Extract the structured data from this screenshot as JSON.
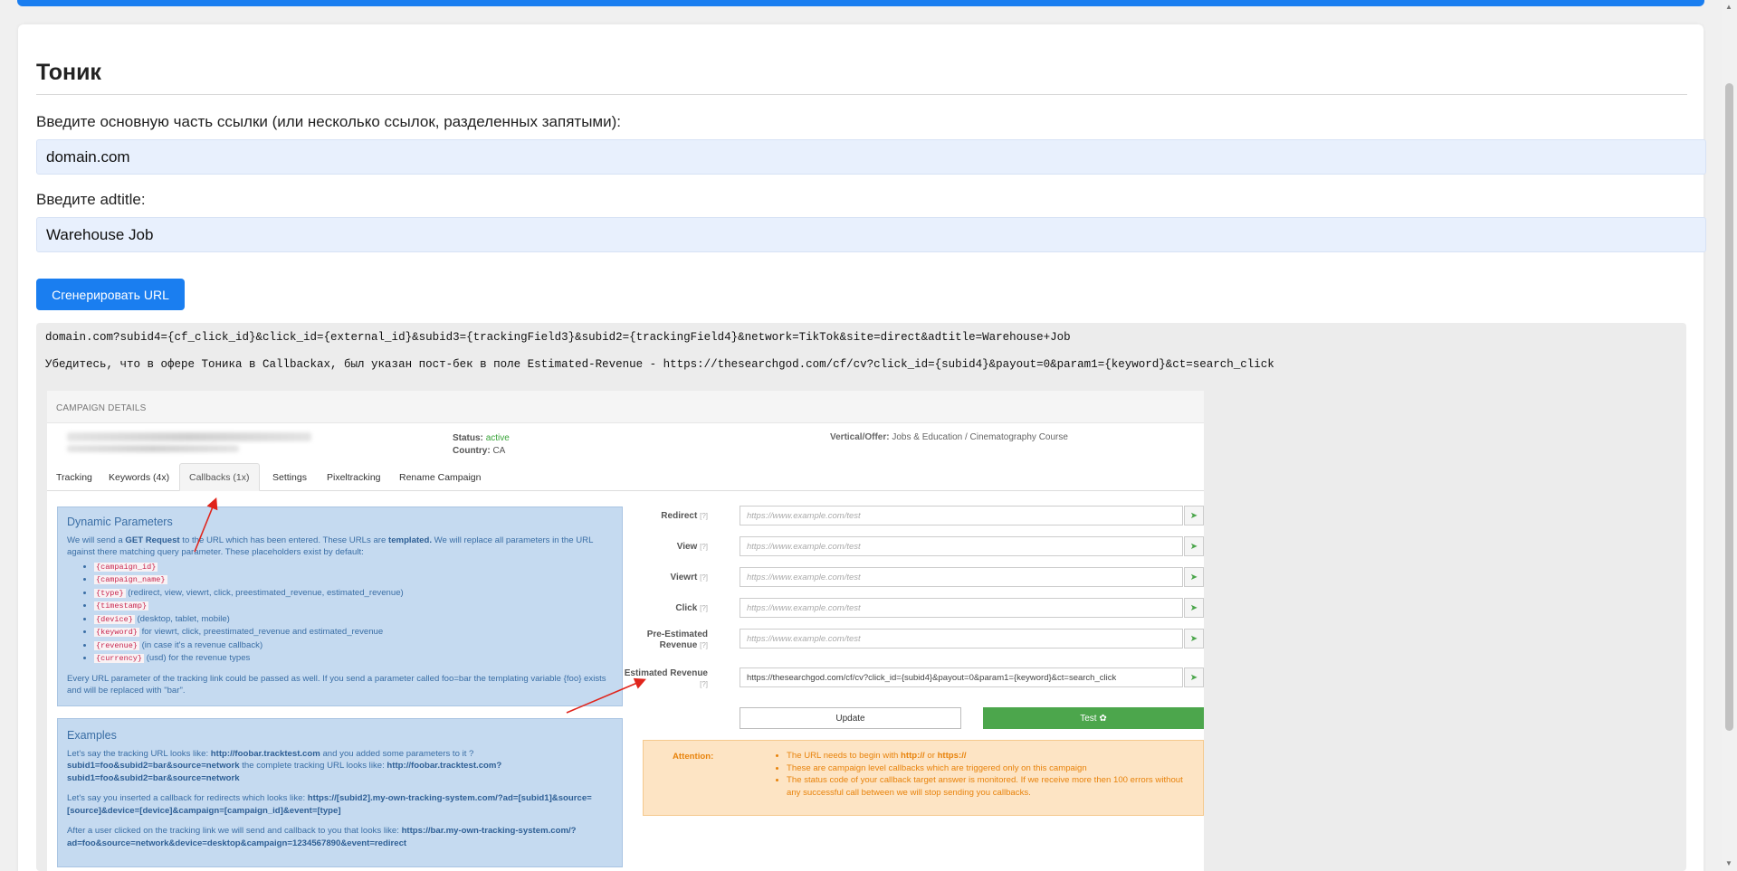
{
  "page": {
    "title": "Тоник",
    "link_label": "Введите основную часть ссылки (или несколько ссылок, разделенных запятыми):",
    "link_value": "domain.com",
    "adtitle_label": "Введите adtitle:",
    "adtitle_value": "Warehouse Job",
    "generate_button": "Сгенерировать URL",
    "result_url": "domain.com?subid4={cf_click_id}&click_id={external_id}&subid3={trackingField3}&subid2={trackingField4}&network=TikTok&site=direct&adtitle=Warehouse+Job",
    "result_note": "Убедитесь, что в офере Тоника в Callbackах, был указан пост-бек в поле Estimated-Revenue - https://thesearchgod.com/cf/cv?click_id={subid4}&payout=0&param1={keyword}&ct=search_click"
  },
  "shot": {
    "header": "CAMPAIGN DETAILS",
    "status_label": "Status:",
    "status_value": "active",
    "country_label": "Country:",
    "country_value": "CA",
    "vertical_label": "Vertical/Offer:",
    "vertical_value": "Jobs & Education / Cinematography Course",
    "tabs": [
      "Tracking",
      "Keywords (4x)",
      "Callbacks (1x)",
      "Settings",
      "Pixeltracking",
      "Rename Campaign"
    ],
    "dyn": {
      "title": "Dynamic Parameters",
      "intro_1": "We will send a",
      "intro_b1": "GET Request",
      "intro_2": "to the URL which has been entered. These URLs are",
      "intro_b2": "templated.",
      "intro_3": "We will replace all parameters in the URL against there matching query parameter. These placeholders exist by default:",
      "items": [
        {
          "code": "{campaign_id}",
          "text": ""
        },
        {
          "code": "{campaign_name}",
          "text": ""
        },
        {
          "code": "{type}",
          "text": "(redirect, view, viewrt, click, preestimated_revenue, estimated_revenue)"
        },
        {
          "code": "{timestamp}",
          "text": ""
        },
        {
          "code": "{device}",
          "text": "(desktop, tablet, mobile)"
        },
        {
          "code": "{keyword}",
          "text": "for viewrt, click, preestimated_revenue and estimated_revenue"
        },
        {
          "code": "{revenue}",
          "text": "(in case it's a revenue callback)"
        },
        {
          "code": "{currency}",
          "text": "(usd) for the revenue types"
        }
      ],
      "outro": "Every URL parameter of the tracking link could be passed as well. If you send a parameter called foo=bar the templating variable {foo} exists and will be replaced with \"bar\"."
    },
    "examples": {
      "title": "Examples",
      "p1_a": "Let's say the tracking URL looks like:",
      "p1_b": "http://foobar.tracktest.com",
      "p1_c": "and you added some parameters to it ?",
      "p1_d": "subid1=foo&subid2=bar&source=network",
      "p1_e": "the complete tracking URL looks like:",
      "p1_f": "http://foobar.tracktest.com?subid1=foo&subid2=bar&source=network",
      "p2_a": "Let's say you inserted a callback for redirects which looks like:",
      "p2_b": "https://[subid2].my-own-tracking-system.com/?ad=[subid1]&source=[source]&device=[device]&campaign=[campaign_id]&event=[type]",
      "p3_a": "After a user clicked on the tracking link we will send and callback to you that looks like:",
      "p3_b": "https://bar.my-own-tracking-system.com/?ad=foo&source=network&device=desktop&campaign=1234567890&event=redirect"
    },
    "fields": [
      {
        "label": "Redirect",
        "value": "https://www.example.com/test",
        "filled": false
      },
      {
        "label": "View",
        "value": "https://www.example.com/test",
        "filled": false
      },
      {
        "label": "Viewrt",
        "value": "https://www.example.com/test",
        "filled": false
      },
      {
        "label": "Click",
        "value": "https://www.example.com/test",
        "filled": false
      },
      {
        "label": "Pre-Estimated Revenue",
        "value": "https://www.example.com/test",
        "filled": false
      },
      {
        "label": "Estimated Revenue",
        "value": "https://thesearchgod.com/cf/cv?click_id={subid4}&payout=0&param1={keyword}&ct=search_click",
        "filled": true
      }
    ],
    "help_mark": "[?]",
    "update_button": "Update",
    "test_button": "Test ✿",
    "attention_label": "Attention:",
    "attention_items": [
      {
        "pre": "The URL needs to begin with ",
        "b1": "http://",
        "mid": " or ",
        "b2": "https://"
      },
      {
        "pre": "These are campaign level callbacks which are triggered only on this campaign",
        "b1": "",
        "mid": "",
        "b2": ""
      },
      {
        "pre": "The status code of your callback target answer is monitored. If we receive more then 100 errors without any successful call between we will stop sending you callbacks.",
        "b1": "",
        "mid": "",
        "b2": ""
      }
    ]
  },
  "colors": {
    "accent": "#1a7ef0",
    "panel_bg": "#c5daf0",
    "attention_bg": "#fde4c4",
    "test_green": "#4ca64c",
    "arrow_red": "#e0241b"
  }
}
